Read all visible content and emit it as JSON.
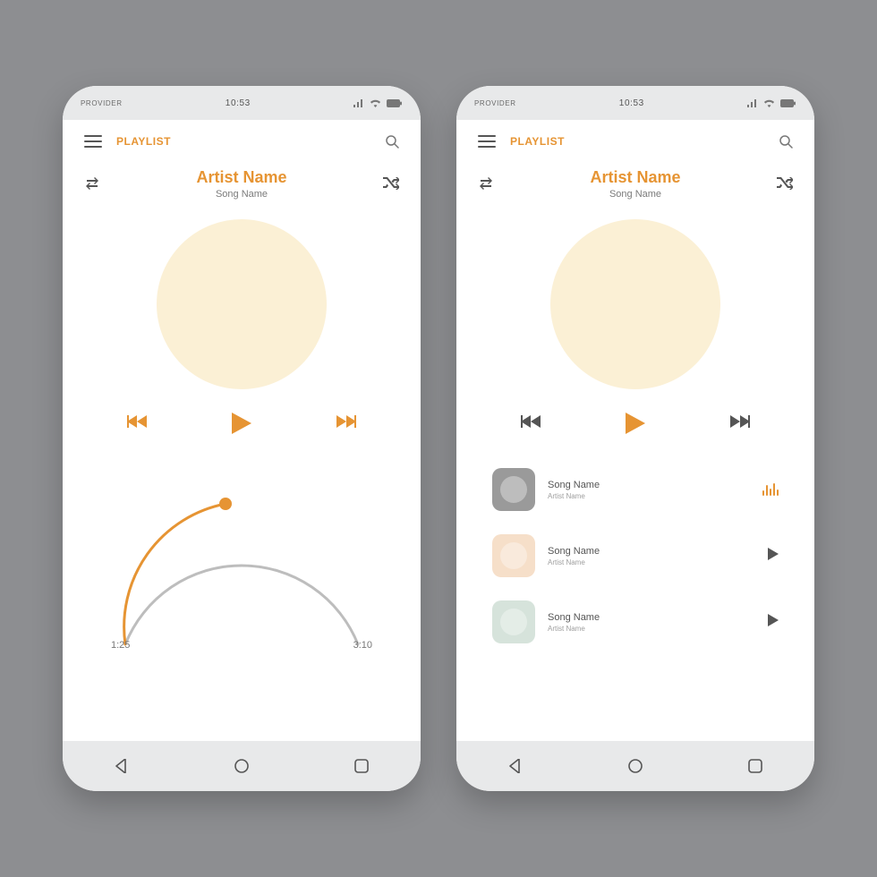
{
  "status": {
    "provider": "PROVIDER",
    "time": "10:53"
  },
  "header": {
    "playlist": "PLAYLIST"
  },
  "player": {
    "artist": "Artist Name",
    "song": "Song Name",
    "elapsed": "1:25",
    "total": "3:10"
  },
  "list": [
    {
      "title": "Song Name",
      "artist": "Artist Name",
      "thumb": "gray",
      "playing": true
    },
    {
      "title": "Song Name",
      "artist": "Artist Name",
      "thumb": "peach",
      "playing": false
    },
    {
      "title": "Song Name",
      "artist": "Artist Name",
      "thumb": "mint",
      "playing": false
    }
  ]
}
